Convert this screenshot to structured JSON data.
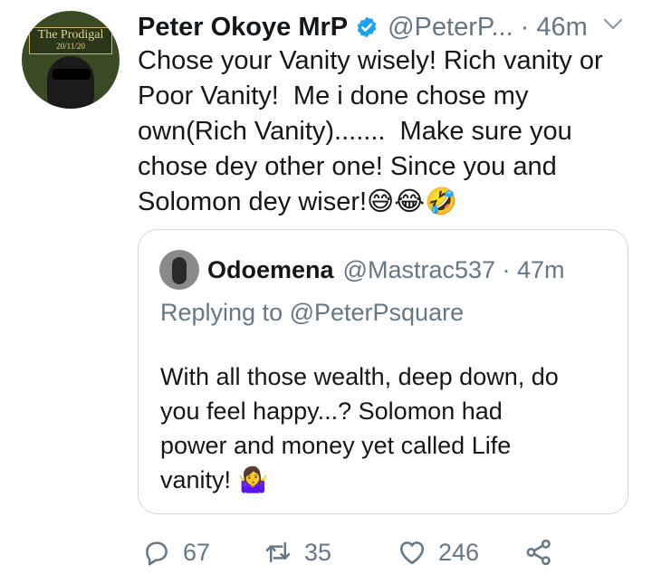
{
  "tweet": {
    "author_name": "Peter Okoye MrP",
    "author_handle": "@PeterP...",
    "time": "· 46m",
    "text": "Chose your Vanity wisely! Rich vanity or\nPoor Vanity!  Me i done chose my\nown(Rich Vanity).......  Make sure you\nchose dey other one! Since you and\nSolomon dey wiser!😅😂🤣",
    "avatar": {
      "title": "The Prodigal",
      "date": "20/11/20"
    }
  },
  "quoted": {
    "author_name": "Odoemena",
    "author_handle": "@Mastrac537 · 47m",
    "replying": "Replying to @PeterPsquare",
    "text": "With all those wealth, deep down, do\nyou feel happy...? Solomon had\npower and money yet called Life\nvanity! 🤷‍♀️"
  },
  "actions": {
    "replies": "67",
    "retweets": "35",
    "likes": "246"
  },
  "colors": {
    "text": "#14171a",
    "muted": "#657786",
    "verified": "#1da1f2",
    "border": "#cfd9de"
  }
}
